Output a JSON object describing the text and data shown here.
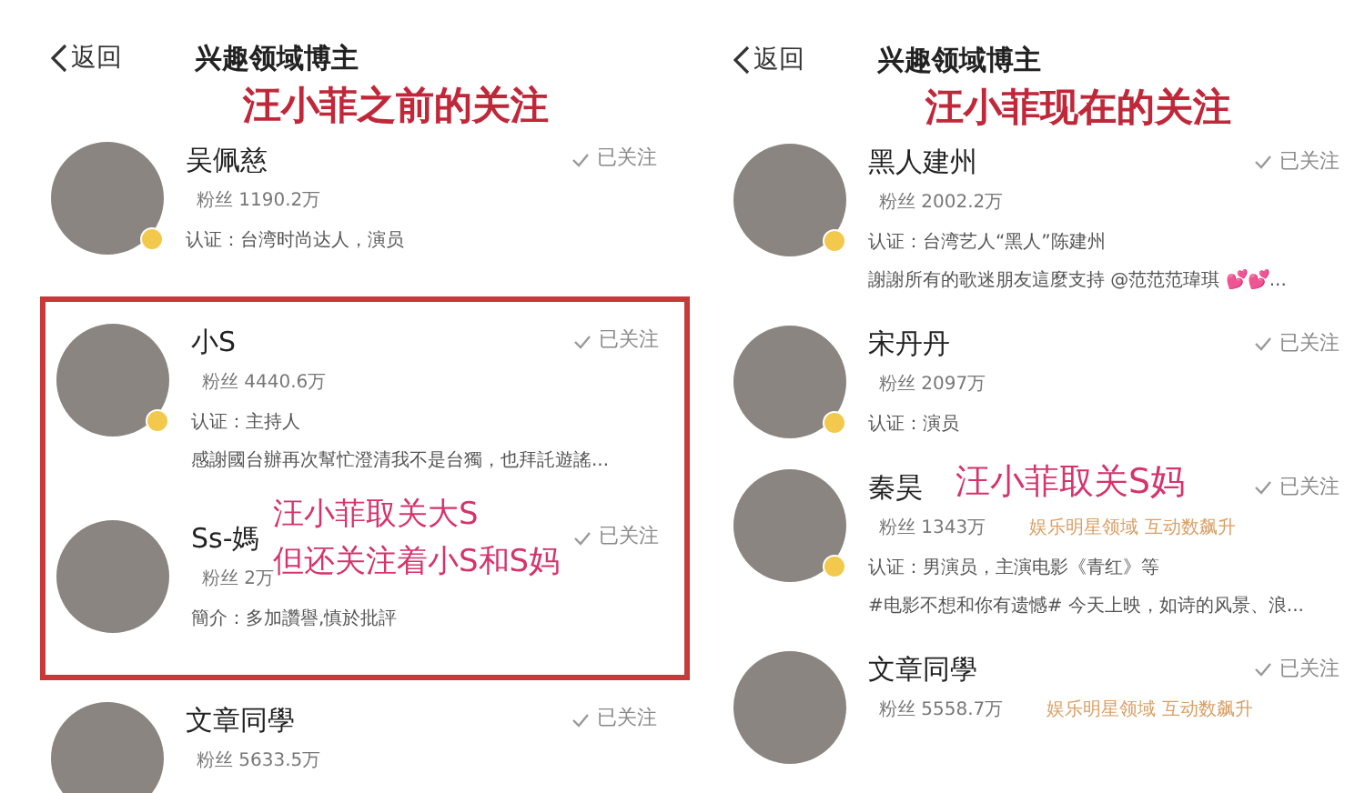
{
  "panels": [
    {
      "back": "返回",
      "title": "兴趣领域博主",
      "annotation": "汪小菲之前的关注",
      "notes": [
        "汪小菲取关大S",
        "但还关注着小S和S妈"
      ],
      "users": [
        {
          "name": "吴佩慈",
          "fans": "粉丝 1190.2万",
          "verified": true,
          "highlighted": false,
          "lines": [
            "认证：台湾时尚达人，演员"
          ],
          "follow": "已关注"
        },
        {
          "name": "小S",
          "fans": "粉丝 4440.6万",
          "verified": true,
          "highlighted": true,
          "lines": [
            "认证：主持人",
            "感謝國台辦再次幫忙澄清我不是台獨，也拜託遊謠..."
          ],
          "follow": "已关注"
        },
        {
          "name": "Ss-媽",
          "fans": "粉丝 2万",
          "verified": false,
          "highlighted": true,
          "lines": [
            "簡介：多加讚譽,慎於批評"
          ],
          "follow": "已关注"
        },
        {
          "name": "文章同學",
          "fans": "粉丝 5633.5万",
          "verified": false,
          "highlighted": false,
          "follow": "已关注"
        }
      ]
    },
    {
      "back": "返回",
      "title": "兴趣领域博主",
      "annotation": "汪小菲现在的关注",
      "notes": [
        "汪小菲取关S妈"
      ],
      "users": [
        {
          "name": "黑人建州",
          "fans": "粉丝 2002.2万",
          "verified": true,
          "highlighted": false,
          "lines": [
            "认证：台湾艺人“黑人”陈建州",
            "謝謝所有的歌迷朋友這麼支持 @范范范瑋琪 💕💕..."
          ],
          "follow": "已关注"
        },
        {
          "name": "宋丹丹",
          "fans": "粉丝 2097万",
          "verified": true,
          "highlighted": false,
          "lines": [
            "认证：演员"
          ],
          "follow": "已关注"
        },
        {
          "name": "秦昊",
          "fans": "粉丝 1343万",
          "tag": "娱乐明星领域 互动数飙升",
          "verified": true,
          "highlighted": false,
          "lines": [
            "认证：男演员，主演电影《青红》等",
            "#电影不想和你有遗憾# 今天上映，如诗的风景、浪..."
          ],
          "follow": "已关注"
        },
        {
          "name": "文章同學",
          "fans": "粉丝 5558.7万",
          "tag": "娱乐明星领域 互动数飙升",
          "verified": false,
          "highlighted": false,
          "follow": "已关注"
        }
      ]
    }
  ]
}
